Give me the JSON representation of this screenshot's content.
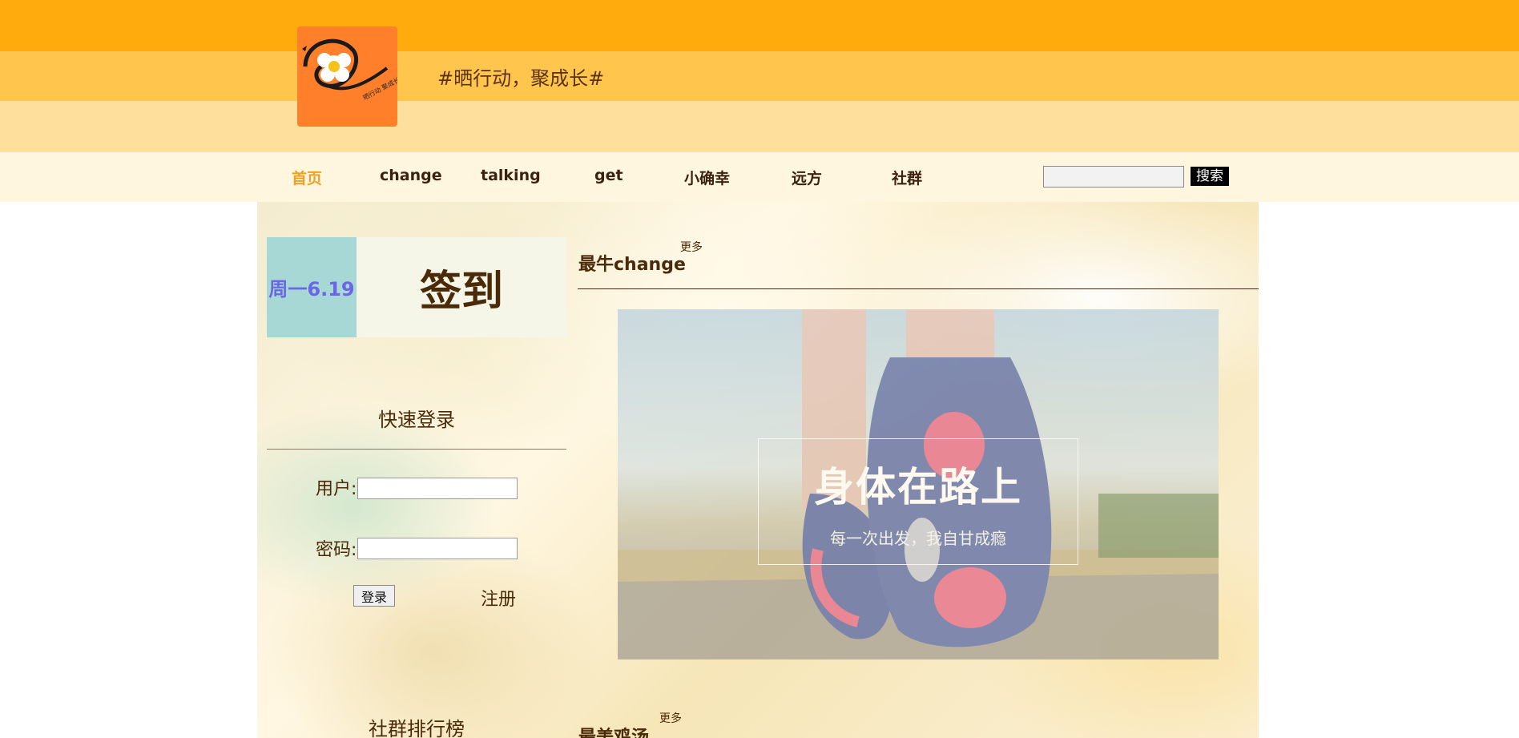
{
  "header": {
    "slogan": "#晒行动，聚成长#",
    "logo_text": "晒行动 聚成长",
    "colors": {
      "band_top": "#ffaa0d",
      "band_middle": "#ffc54d",
      "band_bottom": "#ffdf9c",
      "nav_bg": "#fff6e0",
      "logo_bg": "#ff7f2a"
    }
  },
  "nav": {
    "items": [
      {
        "label": "首页",
        "active": true
      },
      {
        "label": "change",
        "active": false
      },
      {
        "label": "talking",
        "active": false
      },
      {
        "label": "get",
        "active": false
      },
      {
        "label": "小确幸",
        "active": false
      },
      {
        "label": "远方",
        "active": false
      },
      {
        "label": "社群",
        "active": false
      }
    ],
    "search": {
      "value": "",
      "button_label": "搜索"
    },
    "active_color": "#f0a020"
  },
  "sidebar": {
    "date": "周一6.19",
    "checkin_label": "签到",
    "login": {
      "title": "快速登录",
      "user_label": "用户:",
      "password_label": "密码:",
      "login_button": "登录",
      "register_link": "注册"
    },
    "ranking_title": "社群排行榜"
  },
  "content": {
    "section1": {
      "title": "最牛change",
      "more": "更多"
    },
    "banner": {
      "title": "身体在路上",
      "subtitle": "每一次出发，我自甘成瘾"
    },
    "section2": {
      "title": "最美鸡汤",
      "more": "更多"
    }
  }
}
